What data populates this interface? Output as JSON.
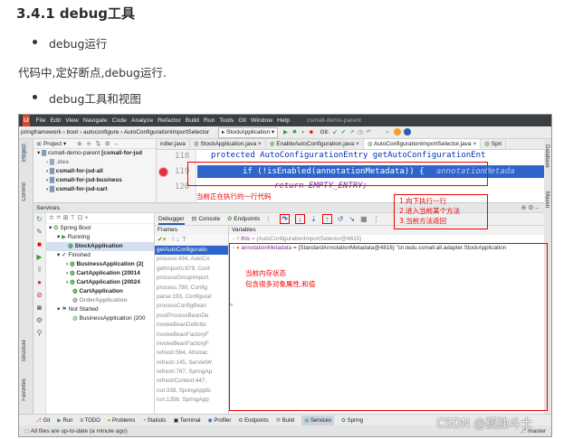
{
  "blog": {
    "heading": "3.4.1 debug工具",
    "bullet1": "debug运行",
    "para1": "代码中,定好断点,debug运行.",
    "bullet2": "debug工具和视图"
  },
  "ide": {
    "menu": [
      "File",
      "Edit",
      "View",
      "Navigate",
      "Code",
      "Analyze",
      "Refactor",
      "Build",
      "Run",
      "Tools",
      "Git",
      "Window",
      "Help"
    ],
    "window_title": "csmall-demo-parent",
    "breadcrumb": [
      "pringframework",
      "boot",
      "autoconfigure",
      "AutoConfigurationImportSelector"
    ],
    "run_config": "StockApplication",
    "git_label": "Git:",
    "project_label": "Project",
    "project_tree": [
      {
        "label": "csmall-demo-parent",
        "suffix": "[csmall-for-jsd"
      },
      {
        "label": ".idea"
      },
      {
        "label": "csmall-for-jsd-all"
      },
      {
        "label": "csmall-for-jsd-business"
      },
      {
        "label": "csmall-for-jsd-cart"
      }
    ],
    "editor_tabs": [
      "roller.java",
      "StockApplication.java",
      "EnableAutoConfiguration.java",
      "AutoConfigurationImportSelector.java",
      "Spri"
    ],
    "code": [
      {
        "line": "118",
        "text": "protected AutoConfigurationEntry getAutoConfigurationEnt"
      },
      {
        "line": "119",
        "text": "if (!isEnabled(annotationMetadata)) {",
        "hint": "annotationMetada"
      },
      {
        "line": "120",
        "text": "return EMPTY_ENTRY;"
      }
    ],
    "services_label": "Services",
    "services_tree": [
      {
        "label": "Spring Boot"
      },
      {
        "label": "Running"
      },
      {
        "label": "StockApplication"
      },
      {
        "label": "Finished"
      },
      {
        "label": "BusinessApplication (2("
      },
      {
        "label": "CartApplication (20014"
      },
      {
        "label": "CartApplication (20024"
      },
      {
        "label": "CartApplication"
      },
      {
        "label": "OrderApplication"
      },
      {
        "label": "Not Started"
      },
      {
        "label": "BusinessApplication (200"
      }
    ],
    "debug_tabs": [
      "Debugger",
      "Console",
      "Endpoints"
    ],
    "frames_label": "Frames",
    "variables_label": "Variables",
    "frames": [
      "getAutoConfiguratio",
      "process:434, AutoCo",
      "getImports:879, Conf",
      "processGroupImport",
      "process:780, Config",
      "parse:193, Configurat",
      "processConfigBean",
      "postProcessBeanDe",
      "invokeBeanDefinitic",
      "invokeBeanFactoryF",
      "invokeBeanFactoryF",
      "refresh:564, Abstrac",
      "refresh:145, ServletW",
      "refresh:767, SpringAp",
      "refreshContext:447,",
      "run:338, SpringApplic",
      "run:1356, SpringApp"
    ],
    "variables": [
      {
        "name": "this",
        "value": "= {AutoConfigurationImportSelector@4815}"
      },
      {
        "name": "annotationMetadata",
        "value": "= {StandardAnnotationMetadata@4816} \"cn.tedu.csmall.all.adapter.StockApplication"
      }
    ],
    "bottom_tabs": [
      "Git",
      "Run",
      "TODO",
      "Problems",
      "Statistic",
      "Terminal",
      "Profiler",
      "Endpoints",
      "Build",
      "Services",
      "Spring"
    ],
    "status_text": "All files are up-to-date (a minute ago)",
    "branch": "master",
    "left_tabs": [
      "Project",
      "Commit",
      "Structure",
      "Favorites"
    ],
    "right_tabs": [
      "Database",
      "Maven"
    ]
  },
  "annotations": {
    "current_line": "当前正在执行的一行代码",
    "buttons": "1.向下执行一行\n2.进入当前某个方法\n3.当前方法返回",
    "vars": "当前内存状态\n包含很多对象属性,和值"
  },
  "watermark": "CSDN @孤独斗士",
  "colors": {
    "accent": "#2a5db0",
    "annot": "#e00000",
    "exec_line": "#2f65ca"
  }
}
